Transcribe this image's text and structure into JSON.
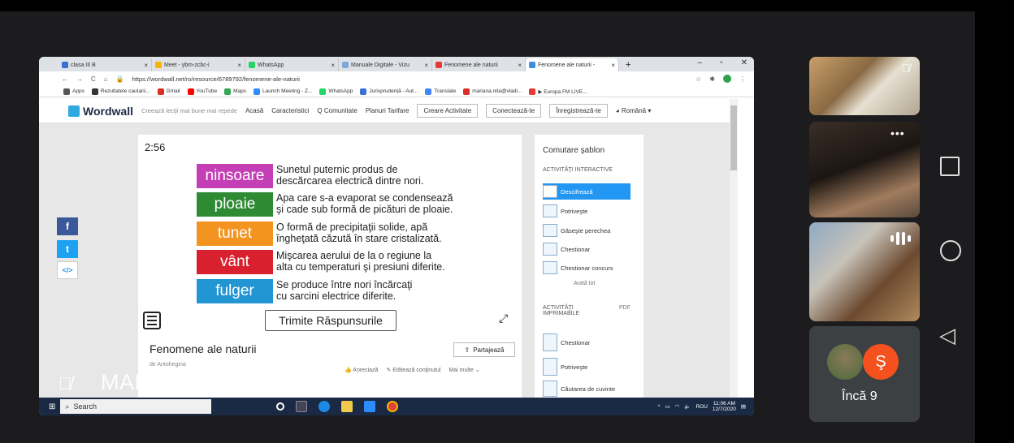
{
  "browser": {
    "tabs": [
      {
        "label": "clasa III B",
        "color": "#3b6fd6",
        "active": false
      },
      {
        "label": "Meet - ybm-zcbc-i",
        "color": "#f4b400",
        "active": false
      },
      {
        "label": "WhatsApp",
        "color": "#25d366",
        "active": false
      },
      {
        "label": "Manuale Digitale - Vizu",
        "color": "#7fa7d8",
        "active": false
      },
      {
        "label": "Fenomene ale naturii",
        "color": "#e53935",
        "active": false
      },
      {
        "label": "Fenomene ale naturii - ",
        "color": "#3b8fe0",
        "active": true
      }
    ],
    "url": "https://wordwall.net/ro/resource/6789792/fenomene-ale-naturii",
    "bookmarks": [
      "Apps",
      "Rezultatele cautarii...",
      "Gmail",
      "YouTube",
      "Maps",
      "Launch Meeting - Z...",
      "WhatsApp",
      "Jurisprudență - Aut...",
      "Translate",
      "mariana.nita@vladi...",
      "▶ Europa FM LIVE..."
    ]
  },
  "wordwall": {
    "logo": "Wordwall",
    "tagline": "Creează lecţii mai bune mai repede",
    "nav": [
      "Acasă",
      "Caracteristici",
      "Comunitate",
      "Planuri Tarifare"
    ],
    "create": "Creare Activitate",
    "login": "Conectează-te",
    "register": "Înregistrează-te",
    "language": "Română"
  },
  "game": {
    "timer": "2:56",
    "words": [
      {
        "word": "ninsoare",
        "color": "#c43fb6",
        "def1": "Sunetul puternic produs de",
        "def2": "descărcarea electrică dintre nori."
      },
      {
        "word": "ploaie",
        "color": "#2e8b34",
        "def1": "Apa care s-a evaporat se condensează",
        "def2": "şi cade sub formă de picături de ploaie."
      },
      {
        "word": "tunet",
        "color": "#f39421",
        "def1": "O formă de precipitaţii solide, apă",
        "def2": "îngheţată căzută în stare cristalizată."
      },
      {
        "word": "vânt",
        "color": "#d8202e",
        "def1": "Mişcarea aerului de la o regiune la",
        "def2": "alta cu temperaturi şi presiuni diferite."
      },
      {
        "word": "fulger",
        "color": "#2196d3",
        "def1": "Se produce între nori încărcaţi",
        "def2": "cu sarcini electrice diferite."
      }
    ],
    "submit": "Trimite Răspunsurile"
  },
  "activity": {
    "title": "Fenomene ale naturii",
    "author": "de Antohegina",
    "share": "Partajează",
    "like": "Apreciază",
    "edit": "Editează conţinutul",
    "more": "Mai multe"
  },
  "template_panel": {
    "heading": "Comutare şablon",
    "interactive_label": "ACTIVITĂŢI INTERACTIVE",
    "interactive": [
      "Descifrează",
      "Potriveşte",
      "Găseşte perechea",
      "Chestionar",
      "Chestionar concurs"
    ],
    "show_all": "Arată tot",
    "printable_label": "ACTIVITĂŢI IMPRIMABILE",
    "pdf": "PDF",
    "printable": [
      "Chestionar",
      "Potriveşte",
      "Căutarea de cuvinte"
    ]
  },
  "social": [
    "f",
    "t",
    "</>"
  ],
  "taskbar": {
    "search": "Search",
    "lang": "ROU",
    "time": "11:06 AM",
    "date": "12/7/2020"
  },
  "meet": {
    "presenter": "MARIANA DANIELA NIŢĂ",
    "avatar_letter": "Ş",
    "more_participants": "Încă 9"
  }
}
